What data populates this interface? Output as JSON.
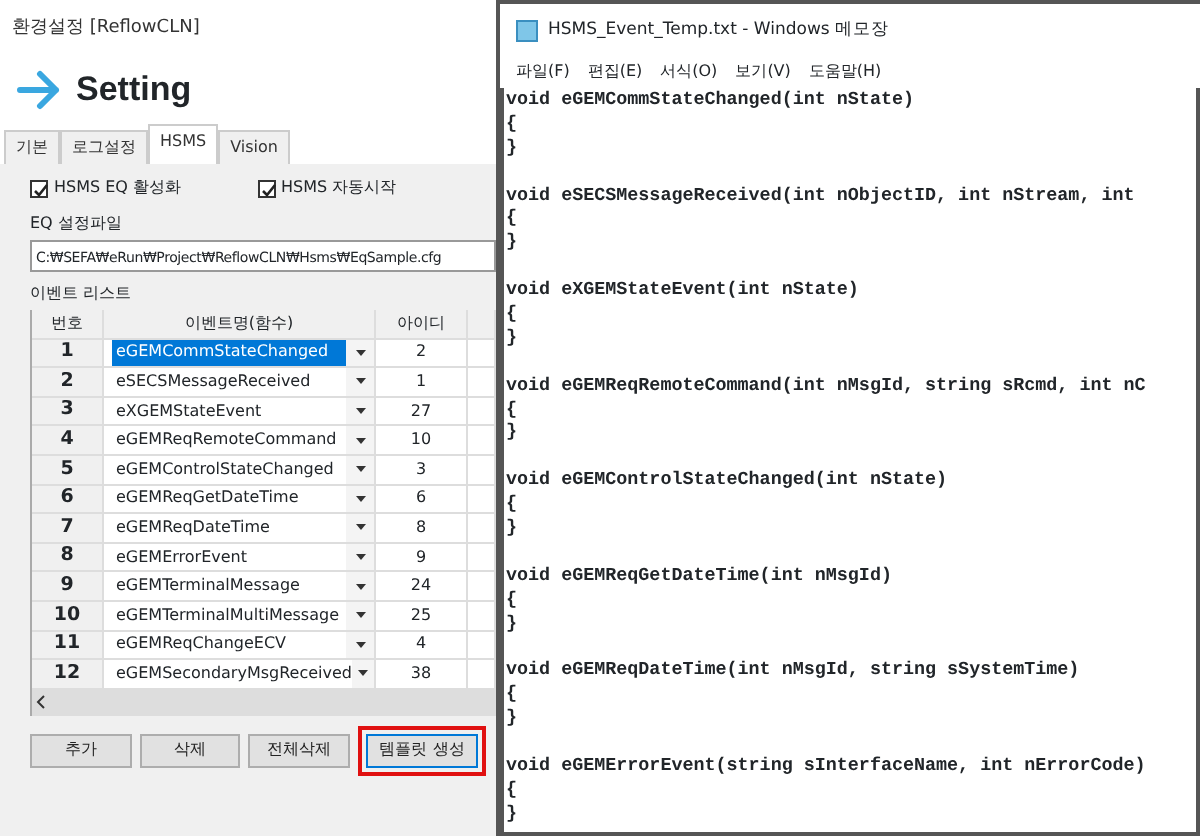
{
  "settings_window": {
    "title": "환경설정 [ReflowCLN]",
    "header": "Setting",
    "tabs": [
      {
        "label": "기본",
        "selected": false
      },
      {
        "label": "로그설정",
        "selected": false
      },
      {
        "label": "HSMS",
        "selected": true
      },
      {
        "label": "Vision",
        "selected": false
      }
    ],
    "checkboxes": [
      {
        "label": "HSMS EQ 활성화",
        "checked": true
      },
      {
        "label": "HSMS 자동시작",
        "checked": true
      }
    ],
    "eq_file": {
      "label": "EQ 설정파일",
      "value": "C:₩SEFA₩eRun₩Project₩ReflowCLN₩Hsms₩EqSample.cfg"
    },
    "event_list": {
      "label": "이벤트 리스트",
      "columns": [
        "번호",
        "이벤트명(함수)",
        "아이디"
      ],
      "rows": [
        {
          "number": "1",
          "event": "eGEMCommStateChanged",
          "id": "2",
          "selected": true
        },
        {
          "number": "2",
          "event": "eSECSMessageReceived",
          "id": "1",
          "selected": false
        },
        {
          "number": "3",
          "event": "eXGEMStateEvent",
          "id": "27",
          "selected": false
        },
        {
          "number": "4",
          "event": "eGEMReqRemoteCommand",
          "id": "10",
          "selected": false
        },
        {
          "number": "5",
          "event": "eGEMControlStateChanged",
          "id": "3",
          "selected": false
        },
        {
          "number": "6",
          "event": "eGEMReqGetDateTime",
          "id": "6",
          "selected": false
        },
        {
          "number": "7",
          "event": "eGEMReqDateTime",
          "id": "8",
          "selected": false
        },
        {
          "number": "8",
          "event": "eGEMErrorEvent",
          "id": "9",
          "selected": false
        },
        {
          "number": "9",
          "event": "eGEMTerminalMessage",
          "id": "24",
          "selected": false
        },
        {
          "number": "10",
          "event": "eGEMTerminalMultiMessage",
          "id": "25",
          "selected": false
        },
        {
          "number": "11",
          "event": "eGEMReqChangeECV",
          "id": "4",
          "selected": false
        },
        {
          "number": "12",
          "event": "eGEMSecondaryMsgReceived",
          "id": "38",
          "selected": false
        }
      ]
    },
    "buttons": [
      {
        "label": "추가",
        "highlighted": false
      },
      {
        "label": "삭제",
        "highlighted": false
      },
      {
        "label": "전체삭제",
        "highlighted": false
      },
      {
        "label": "템플릿 생성",
        "highlighted": true
      }
    ]
  },
  "notepad": {
    "title": "HSMS_Event_Temp.txt - Windows 메모장",
    "menu": [
      "파일(F)",
      "편집(E)",
      "서식(O)",
      "보기(V)",
      "도움말(H)"
    ],
    "functions": [
      {
        "lines": [
          "void eGEMCommStateChanged(int nState)",
          "{",
          "}"
        ]
      },
      {
        "lines": [
          "void eSECSMessageReceived(int nObjectID, int nStream, int",
          "{",
          "}"
        ]
      },
      {
        "lines": [
          "void eXGEMStateEvent(int nState)",
          "{",
          "}"
        ]
      },
      {
        "lines": [
          "void eGEMReqRemoteCommand(int nMsgId, string sRcmd, int nC",
          "{",
          "}"
        ]
      },
      {
        "lines": [
          "void eGEMControlStateChanged(int nState)",
          "{",
          "}"
        ]
      },
      {
        "lines": [
          "void eGEMReqGetDateTime(int nMsgId)",
          "{",
          "}"
        ]
      },
      {
        "lines": [
          "void eGEMReqDateTime(int nMsgId, string sSystemTime)",
          "{",
          "}"
        ]
      },
      {
        "lines": [
          "void eGEMErrorEvent(string sInterfaceName, int nErrorCode)",
          "{",
          "}"
        ]
      }
    ]
  }
}
